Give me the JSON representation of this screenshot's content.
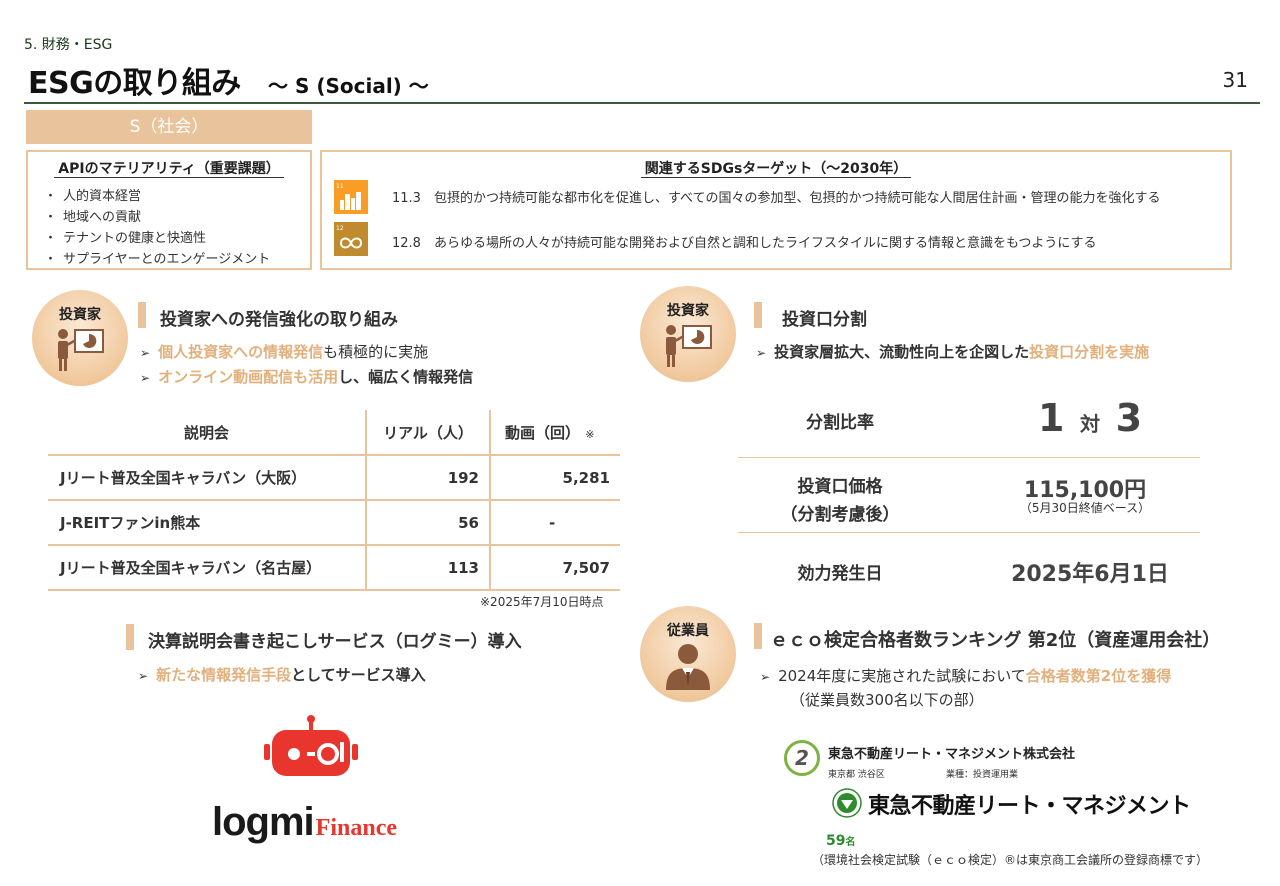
{
  "header": {
    "section": "5. 財務・ESG",
    "title": "ESGの取り組み",
    "subtitle": "～ S (Social) ～",
    "page_number": "31"
  },
  "social_label": "S（社会）",
  "materiality": {
    "title": "APIのマテリアリティ（重要課題）",
    "items": [
      "人的資本経営",
      "地域への貢献",
      "テナントの健康と快適性",
      "サプライヤーとのエンゲージメント"
    ]
  },
  "sdgs": {
    "title": "関連するSDGsターゲット（～2030年）",
    "targets": [
      {
        "icon": "sdg-11-icon",
        "color": "#f99d26",
        "number": "11",
        "text": "11.3　包摂的かつ持続可能な都市化を促進し、すべての国々の参加型、包摂的かつ持続可能な人間居住計画・管理の能力を強化する"
      },
      {
        "icon": "sdg-12-icon",
        "color": "#bf8b2e",
        "number": "12",
        "text": "12.8　あらゆる場所の人々が持続可能な開発および自然と調和したライフスタイルに関する情報と意識をもつようにする"
      }
    ]
  },
  "investor_comm": {
    "badge": "投資家",
    "heading": "投資家への発信強化の取り組み",
    "bullet1_hl": "個人投資家への情報発信",
    "bullet1_rest": "も積極的に実施",
    "bullet2_hl": "オンライン動画配信も活用",
    "bullet2_rest": "し、幅広く情報発信",
    "table": {
      "headers": [
        "説明会",
        "リアル（人）",
        "動画（回）"
      ],
      "header_note": "※",
      "rows": [
        [
          "Jリート普及全国キャラバン（大阪）",
          "192",
          "5,281"
        ],
        [
          "J-REITファンin熊本",
          "56",
          "-"
        ],
        [
          "Jリート普及全国キャラバン（名古屋）",
          "113",
          "7,507"
        ]
      ],
      "footnote": "※2025年7月10日時点"
    }
  },
  "logmi": {
    "heading": "決算説明会書き起こしサービス（ログミー）導入",
    "bullet_hl": "新たな情報発信手段",
    "bullet_rest": "としてサービス導入",
    "logo_word": "logmi",
    "logo_suffix": "Finance",
    "brand_color": "#e8362e"
  },
  "unit_split": {
    "badge": "投資家",
    "heading": "投資口分割",
    "bullet_text": "投資家層拡大、流動性向上を企図した",
    "bullet_hl": "投資口分割を実施",
    "ratio_label": "分割比率",
    "ratio_left": "1",
    "ratio_mid": "対",
    "ratio_right": "3",
    "price_label_1": "投資口価格",
    "price_label_2": "（分割考慮後）",
    "price_value": "115,100円",
    "price_note": "（5月30日終値ベース）",
    "effective_label": "効力発生日",
    "effective_value": "2025年6月1日"
  },
  "eco": {
    "badge": "従業員",
    "heading": "ｅｃｏ検定合格者数ランキング 第2位（資産運用会社）",
    "bullet_text": "2024年度に実施された試験において",
    "bullet_hl": "合格者数第2位を獲得",
    "bullet_sub": "（従業員数300名以下の部）",
    "rank": "2",
    "company": "東急不動産リート・マネジメント株式会社",
    "location": "東京都 渋谷区",
    "industry": "業種：投資運用業",
    "logo_text": "東急不動産リート・マネジメント",
    "count": "59",
    "count_unit": "名",
    "footnote": "（環境社会検定試験（ｅｃｏ検定）®は東京商工会議所の登録商標です）"
  },
  "colors": {
    "accent": "#e9c39b",
    "highlight": "#e2b07c",
    "rule": "#3b5a3b",
    "eco_green": "#2e8b2e"
  }
}
